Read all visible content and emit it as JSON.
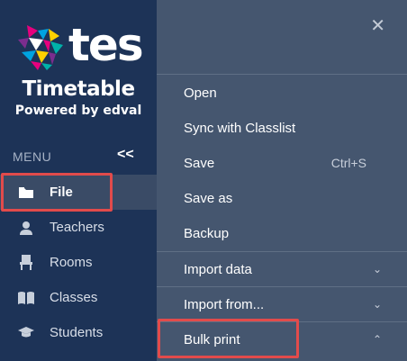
{
  "brand": {
    "logo_text": "tes",
    "product": "Timetable",
    "powered_by": "Powered by edval"
  },
  "sidebar": {
    "menu_label": "MENU",
    "collapse_label": "<<",
    "items": [
      {
        "label": "File",
        "icon": "folder-icon",
        "active": true
      },
      {
        "label": "Teachers",
        "icon": "person-icon"
      },
      {
        "label": "Rooms",
        "icon": "chair-icon"
      },
      {
        "label": "Classes",
        "icon": "book-icon"
      },
      {
        "label": "Students",
        "icon": "graduation-cap-icon"
      }
    ]
  },
  "file_menu": {
    "close_label": "✕",
    "items": [
      {
        "label": "Open"
      },
      {
        "label": "Sync with Classlist"
      },
      {
        "label": "Save",
        "shortcut": "Ctrl+S"
      },
      {
        "label": "Save as"
      },
      {
        "label": "Backup"
      },
      {
        "label": "Import data",
        "chevron": "⌄"
      },
      {
        "label": "Import from...",
        "chevron": "⌄"
      },
      {
        "label": "Bulk print",
        "chevron": "⌃"
      }
    ]
  },
  "colors": {
    "sidebar_bg": "#1d3357",
    "panel_bg": "#45566f",
    "highlight": "#e24b4b"
  }
}
